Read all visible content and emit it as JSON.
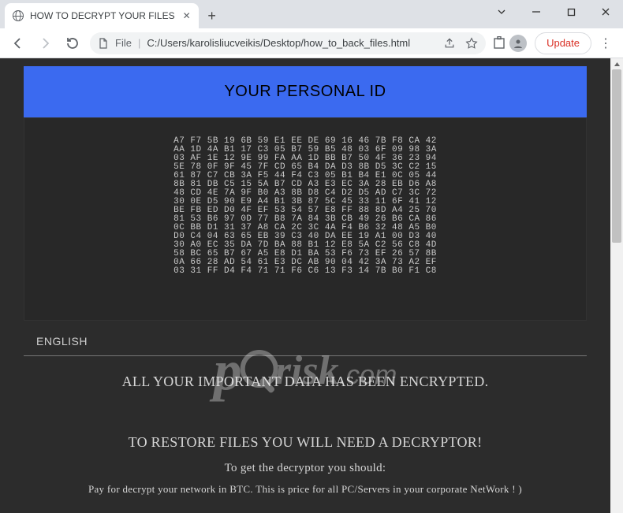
{
  "tab": {
    "title": "HOW TO DECRYPT YOUR FILES"
  },
  "omnibox": {
    "scheme_label": "File",
    "path": "C:/Users/karolisliucveikis/Desktop/how_to_back_files.html",
    "update_label": "Update"
  },
  "page": {
    "banner": "YOUR PERSONAL ID",
    "hex_lines": [
      "A7 F7 5B 19 6B 59 E1 EE DE 69 16 46 7B F8 CA 42",
      "AA 1D 4A B1 17 C3 05 B7 59 B5 48 03 6F 09 98 3A",
      "03 AF 1E 12 9E 99 FA AA 1D BB B7 50 4F 36 23 94",
      "5E 78 0F 9F 45 7F CD 65 B4 DA D3 8B D5 3C C2 15",
      "61 87 C7 CB 3A F5 44 F4 C3 05 B1 B4 E1 0C 05 44",
      "8B 81 DB C5 15 5A B7 CD A3 E3 EC 3A 28 EB D6 A8",
      "48 CD 4E 7A 9F B0 A3 8B D8 C4 D2 D5 AD C7 3C 72",
      "30 0E D5 90 E9 A4 B1 3B 87 5C 45 33 11 6F 41 12",
      "BE FB ED D0 4F EF 53 54 57 E8 FF 88 8D A4 25 70",
      "81 53 B6 97 0D 77 B8 7A 84 3B CB 49 26 B6 CA 86",
      "0C BB D1 31 37 A8 CA 2C 3C 4A F4 B6 32 48 A5 B0",
      "D0 C4 04 63 65 EB 39 C3 40 DA EE 19 A1 00 D3 40",
      "30 A0 EC 35 DA 7D BA 88 B1 12 E8 5A C2 56 C8 4D",
      "58 BC 65 B7 67 A5 E8 D1 BA 53 F6 73 EF 26 57 8B",
      "0A 66 28 AD 54 61 E3 DC AB 90 04 42 3A 73 A2 EF",
      "03 31 FF D4 F4 71 71 F6 C6 13 F3 14 7B B0 F1 C8"
    ],
    "language_label": "ENGLISH",
    "headline": "ALL YOUR IMPORTANT DATA HAS BEEN ENCRYPTED.",
    "subhead": "TO RESTORE FILES YOU WILL NEED A DECRYPTOR!",
    "hint": "To get the decryptor you should:",
    "pay_line": "Pay for decrypt your network in BTC. This is price for all PC/Servers in your corporate NetWork ! )"
  },
  "watermark": {
    "p": "p",
    "risk": "risk",
    "dotcom": ".com"
  }
}
